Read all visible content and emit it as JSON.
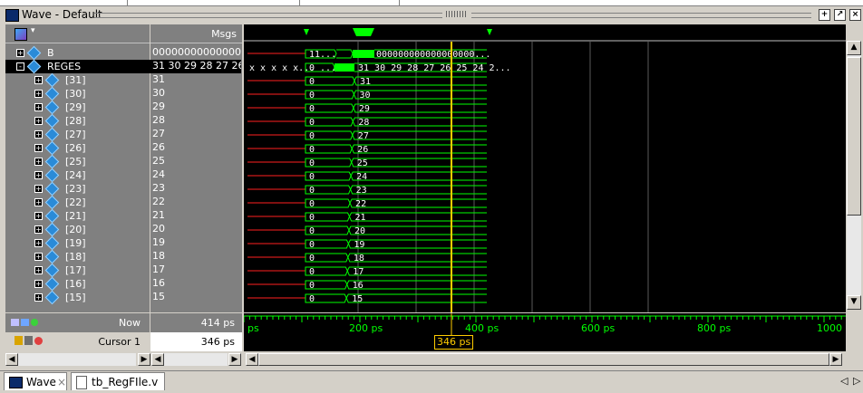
{
  "window": {
    "title": "Wave - Default"
  },
  "signal_pane": {
    "msgs_header": "Msgs",
    "signals": [
      {
        "name": "B",
        "value": "00000000000000...",
        "expand": "+"
      },
      {
        "name": "REGES",
        "value": "31 30 29 28 27 26...",
        "expand": "-"
      },
      {
        "name": "[31]",
        "value": "31",
        "expand": "+"
      },
      {
        "name": "[30]",
        "value": "30",
        "expand": "+"
      },
      {
        "name": "[29]",
        "value": "29",
        "expand": "+"
      },
      {
        "name": "[28]",
        "value": "28",
        "expand": "+"
      },
      {
        "name": "[27]",
        "value": "27",
        "expand": "+"
      },
      {
        "name": "[26]",
        "value": "26",
        "expand": "+"
      },
      {
        "name": "[25]",
        "value": "25",
        "expand": "+"
      },
      {
        "name": "[24]",
        "value": "24",
        "expand": "+"
      },
      {
        "name": "[23]",
        "value": "23",
        "expand": "+"
      },
      {
        "name": "[22]",
        "value": "22",
        "expand": "+"
      },
      {
        "name": "[21]",
        "value": "21",
        "expand": "+"
      },
      {
        "name": "[20]",
        "value": "20",
        "expand": "+"
      },
      {
        "name": "[19]",
        "value": "19",
        "expand": "+"
      },
      {
        "name": "[18]",
        "value": "18",
        "expand": "+"
      },
      {
        "name": "[17]",
        "value": "17",
        "expand": "+"
      },
      {
        "name": "[16]",
        "value": "16",
        "expand": "+"
      },
      {
        "name": "[15]",
        "value": "15",
        "expand": "+"
      }
    ]
  },
  "waves": {
    "b_segments": [
      "11...",
      "000000000000000000..."
    ],
    "reges_segments": [
      "x x x x x...",
      "0 ...",
      "31 30 29 28 27 26 25 24 2..."
    ],
    "row_start": "0",
    "row_values": [
      "31",
      "30",
      "29",
      "28",
      "27",
      "26",
      "25",
      "24",
      "23",
      "22",
      "21",
      "20",
      "19",
      "18",
      "17",
      "16",
      "15"
    ]
  },
  "footer": {
    "now_label": "Now",
    "now_value": "414 ps",
    "cursor_label": "Cursor 1",
    "cursor_value": "346 ps",
    "cursor_marker": "346 ps",
    "timeline_labels": [
      "ps",
      "200 ps",
      "400 ps",
      "600 ps",
      "800 ps",
      "1000"
    ]
  },
  "tabs": [
    {
      "label": "Wave"
    },
    {
      "label": "tb_RegFIle.v"
    }
  ],
  "colors": {
    "wave": "#00ff00",
    "cursor": "#ffcc00",
    "bg": "#000000",
    "pane": "#808080"
  }
}
